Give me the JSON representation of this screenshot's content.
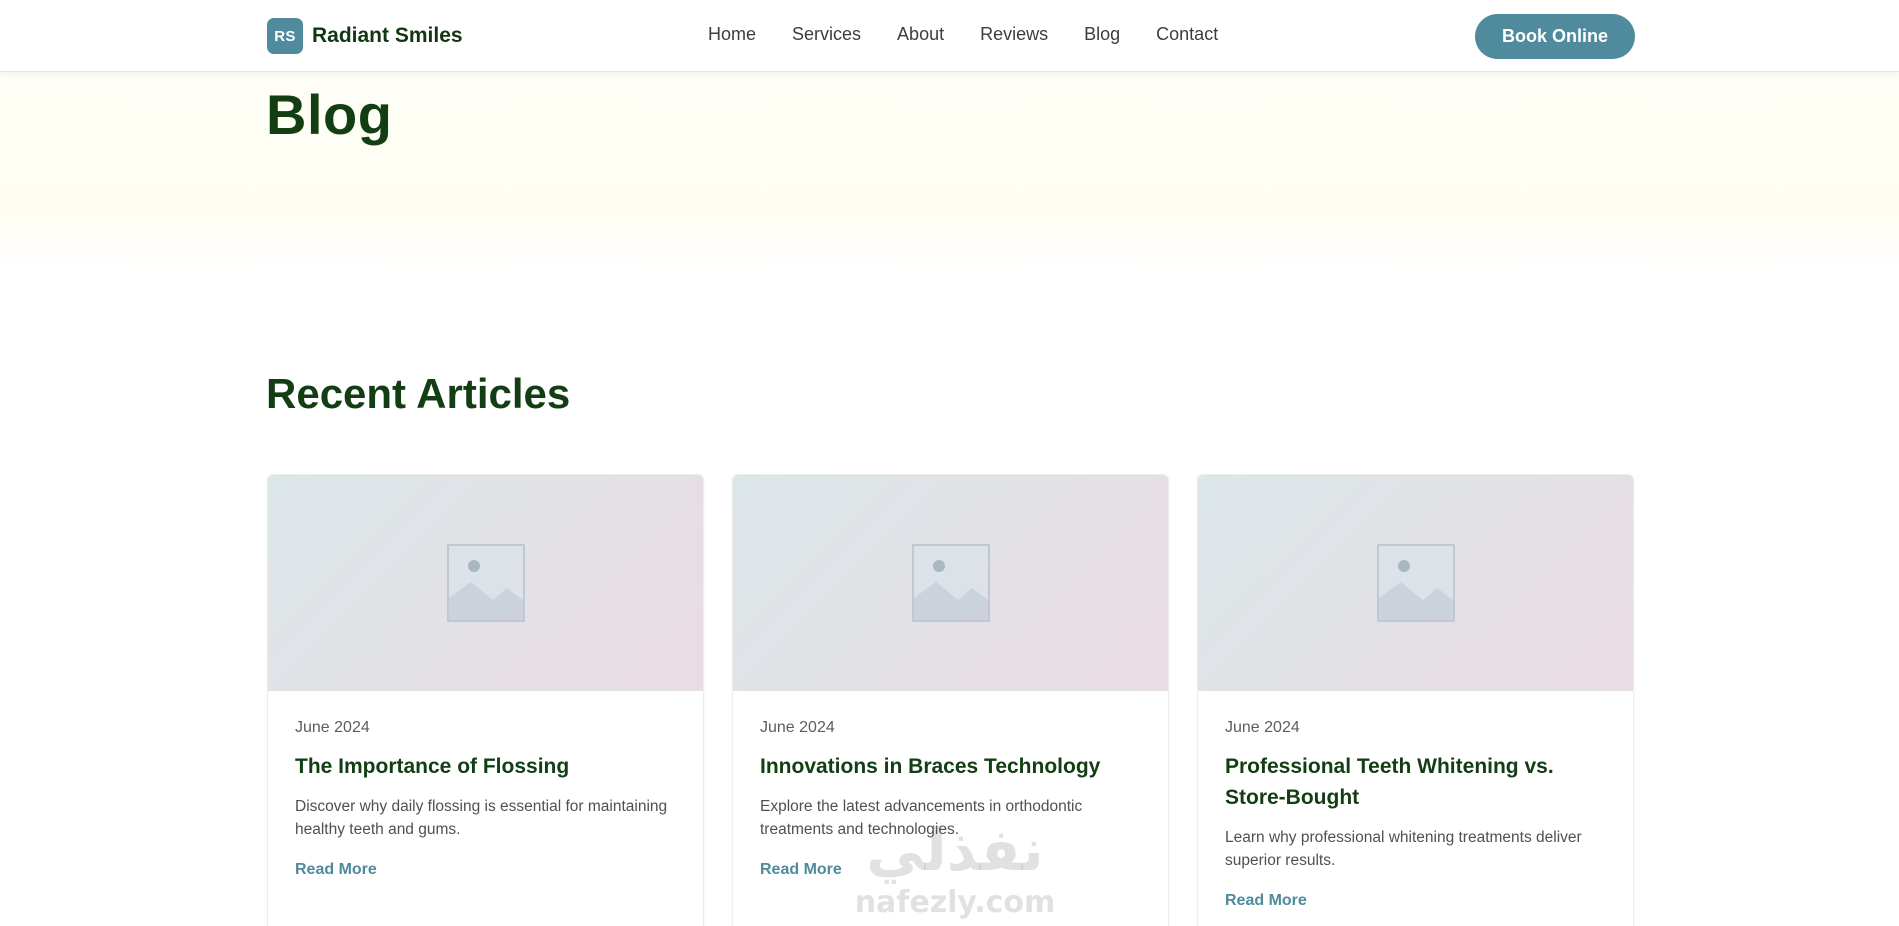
{
  "header": {
    "logo_initials": "RS",
    "brand_name": "Radiant Smiles",
    "nav": [
      "Home",
      "Services",
      "About",
      "Reviews",
      "Blog",
      "Contact"
    ],
    "cta_label": "Book Online"
  },
  "hero": {
    "title": "Blog"
  },
  "articles_section": {
    "title": "Recent Articles",
    "cards": [
      {
        "date": "June 2024",
        "title": "The Importance of Flossing",
        "excerpt": "Discover why daily flossing is essential for maintaining healthy teeth and gums.",
        "link": "Read More"
      },
      {
        "date": "June 2024",
        "title": "Innovations in Braces Technology",
        "excerpt": "Explore the latest advancements in orthodontic treatments and technologies.",
        "link": "Read More"
      },
      {
        "date": "June 2024",
        "title": "Professional Teeth Whitening vs. Store-Bought",
        "excerpt": "Learn why professional whitening treatments deliver superior results.",
        "link": "Read More"
      }
    ]
  },
  "watermark": {
    "arabic": "نفذلي",
    "latin": "nafezly.com"
  },
  "colors": {
    "accent": "#4f8b9c",
    "heading": "#133d13",
    "hero_bg": "#fffdf3"
  }
}
